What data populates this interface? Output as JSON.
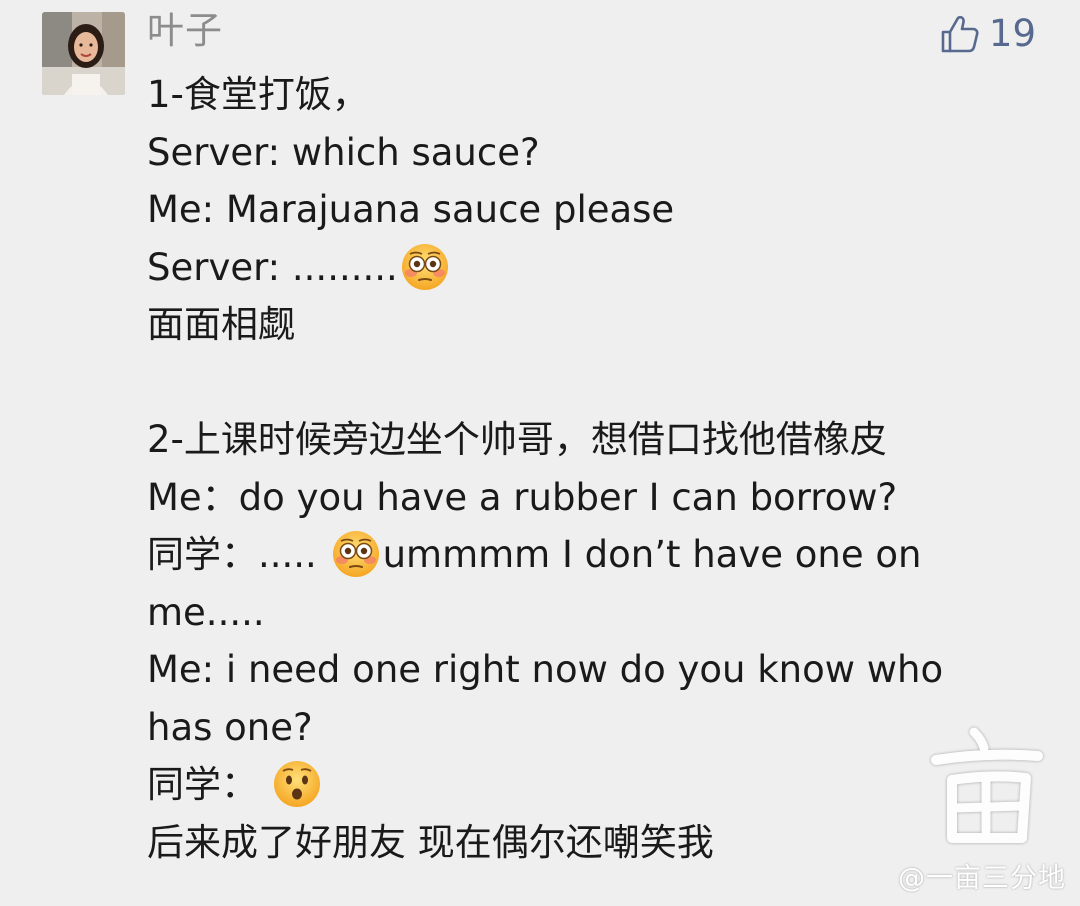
{
  "comment": {
    "author": "叶子",
    "likes": "19",
    "icons": {
      "like": "thumbs-up-icon",
      "avatar": "user-avatar"
    },
    "lines": [
      {
        "segments": [
          {
            "text": "1-食堂打饭，"
          }
        ]
      },
      {
        "segments": [
          {
            "text": "Server: which sauce?"
          }
        ]
      },
      {
        "segments": [
          {
            "text": "Me: Marajuana sauce please"
          }
        ]
      },
      {
        "segments": [
          {
            "text": "Server: ........."
          },
          {
            "emoji": "flushed-face-emoji"
          }
        ]
      },
      {
        "segments": [
          {
            "text": "面面相觑"
          }
        ]
      },
      {
        "segments": [
          {
            "text": ""
          }
        ]
      },
      {
        "segments": [
          {
            "text": "2-上课时候旁边坐个帅哥，想借口找他借橡皮"
          }
        ]
      },
      {
        "segments": [
          {
            "text": "Me：do you have a rubber I can borrow?"
          }
        ]
      },
      {
        "segments": [
          {
            "text": "同学：..... "
          },
          {
            "emoji": "flushed-face-emoji"
          },
          {
            "text": "ummmm I don’t have one on"
          }
        ]
      },
      {
        "segments": [
          {
            "text": "me....."
          }
        ]
      },
      {
        "segments": [
          {
            "text": "Me:  i need one right now do you know who"
          }
        ]
      },
      {
        "segments": [
          {
            "text": "has one?"
          }
        ]
      },
      {
        "segments": [
          {
            "text": "同学： "
          },
          {
            "emoji": "hushed-face-emoji"
          }
        ]
      },
      {
        "segments": [
          {
            "text": "后来成了好朋友 现在偶尔还嘲笑我"
          }
        ]
      }
    ]
  },
  "watermark": {
    "text": "@一亩三分地",
    "logo": "亩"
  },
  "colors": {
    "background": "#efefef",
    "author": "#8c8c8c",
    "like": "#57698f",
    "text": "#1a1a1a"
  }
}
